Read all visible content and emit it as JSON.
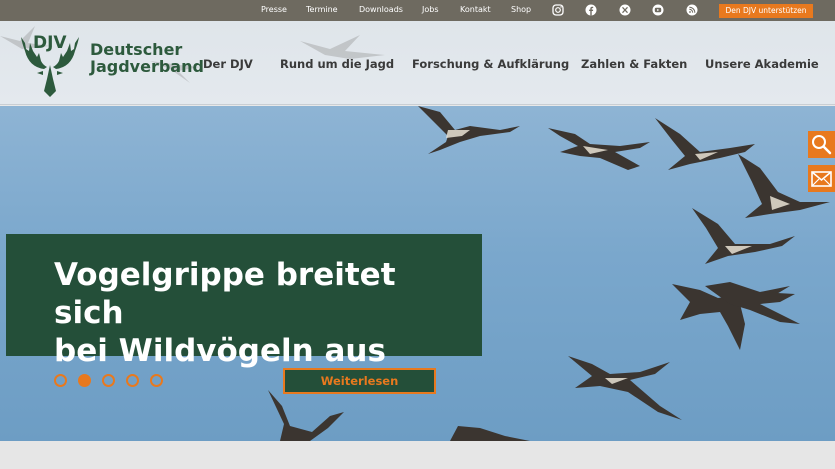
{
  "topbar": {
    "links": [
      "Presse",
      "Termine",
      "Downloads",
      "Jobs",
      "Kontakt",
      "Shop"
    ],
    "social_icons": [
      "instagram-icon",
      "facebook-icon",
      "x-icon",
      "youtube-icon",
      "rss-icon"
    ],
    "cta_label": "Den DJV unterstützen"
  },
  "logo": {
    "mark": "DJV",
    "line1": "Deutscher",
    "line2": "Jagdverband"
  },
  "nav": {
    "items": [
      "Der DJV",
      "Rund um die Jagd",
      "Forschung & Aufklärung",
      "Zahlen & Fakten",
      "Unsere Akademie"
    ]
  },
  "hero": {
    "headline_line1": "Vogelgrippe breitet sich",
    "headline_line2": "bei Wildvögeln aus",
    "button_label": "Weiterlesen",
    "slide_count": 5,
    "active_slide": 2
  },
  "side_buttons": [
    "search-icon",
    "mail-icon"
  ],
  "colors": {
    "accent": "#e8791e",
    "brand_green": "#244f39",
    "topbar": "#6e6a60"
  }
}
